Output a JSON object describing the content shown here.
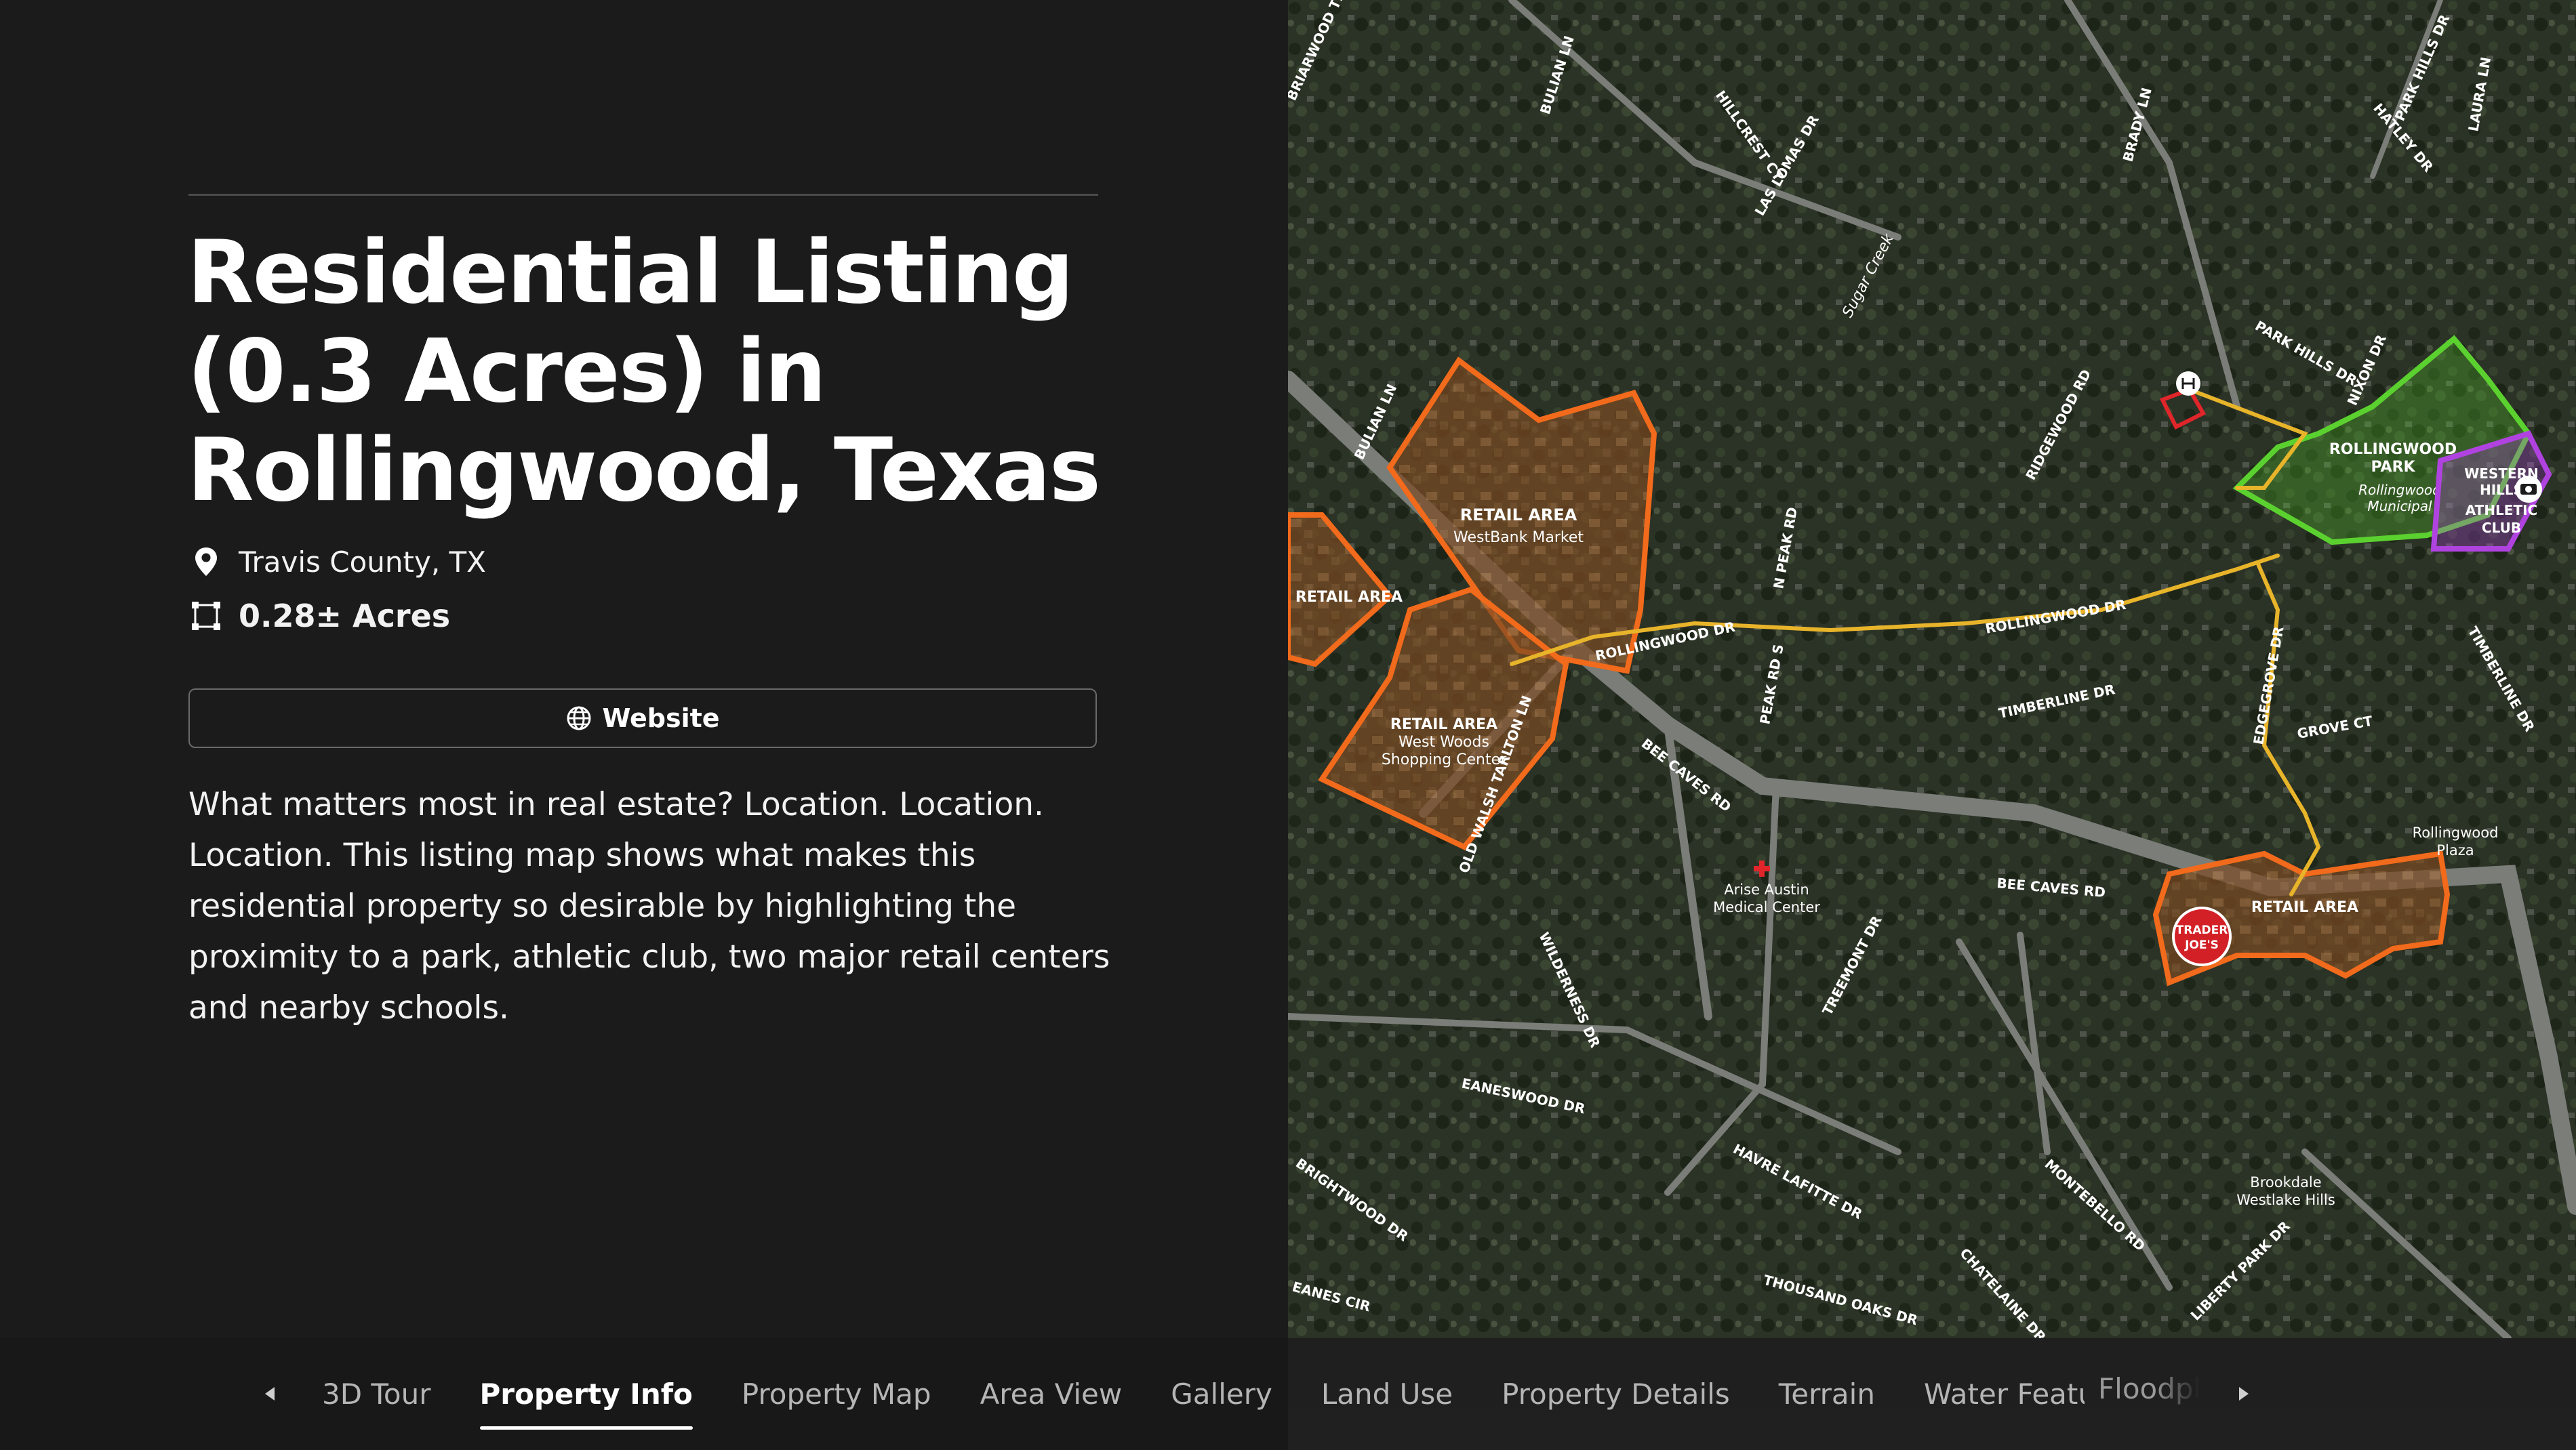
{
  "listing": {
    "title": "Residential Listing (0.3 Acres) in Rollingwood, Texas",
    "location": "Travis County, TX",
    "acreage": "0.28± Acres",
    "website_label": "Website",
    "description": "What matters most in real estate? Location. Location. Location. This listing map shows what makes this residential property so desirable by highlighting the proximity to a park, athletic club, two major retail centers and nearby schools."
  },
  "icons": {
    "location": "map-pin-icon",
    "acreage": "boundary-square-icon",
    "website": "globe-icon",
    "prev": "caret-left-icon",
    "next": "caret-right-icon"
  },
  "colors": {
    "panel_bg": "#1b1b1c",
    "retail_outline": "#f26a1b",
    "park_outline": "#5bd12f",
    "club_outline": "#b043e0",
    "route_line": "#e8b42a",
    "property_outline": "#e0262a"
  },
  "tabs": [
    {
      "label": "3D Tour",
      "active": false
    },
    {
      "label": "Property Info",
      "active": true
    },
    {
      "label": "Property Map",
      "active": false
    },
    {
      "label": "Area View",
      "active": false
    },
    {
      "label": "Gallery",
      "active": false
    },
    {
      "label": "Land Use",
      "active": false
    },
    {
      "label": "Property Details",
      "active": false
    },
    {
      "label": "Terrain",
      "active": false
    },
    {
      "label": "Water Features",
      "active": false
    }
  ],
  "tab_partial": "Floodpla",
  "map": {
    "areas": {
      "retail_westbank": [
        "RETAIL AREA",
        "WestBank Market"
      ],
      "retail_left": "RETAIL AREA",
      "retail_westwoods": [
        "RETAIL AREA",
        "West Woods",
        "Shopping Center"
      ],
      "retail_traderjoes": "RETAIL AREA",
      "park": [
        "ROLLINGWOOD",
        "PARK"
      ],
      "club": [
        "WESTERN",
        "HILLS",
        "ATHLETIC",
        "CLUB"
      ],
      "park_sub": [
        "Rollingwood",
        "Municipal"
      ]
    },
    "poi": {
      "trader_joes": [
        "TRADER",
        "JOE'S"
      ],
      "arise": [
        "Arise Austin",
        "Medical Center"
      ],
      "rollingwood_plaza": [
        "Rollingwood",
        "Plaza"
      ],
      "brookdale": [
        "Brookdale",
        "Westlake Hills"
      ],
      "sugar_creek": "Sugar Creek"
    },
    "roads": {
      "rollingwood_dr_w": "ROLLINGWOOD DR",
      "rollingwood_dr_e": "ROLLINGWOOD DR",
      "bee_caves_rd_w": "BEE CAVES RD",
      "bee_caves_rd_e": "BEE CAVES RD",
      "edgegrove_dr": "EDGEGROVE DR",
      "timberline_dr": "TIMBERLINE DR",
      "timberline_dr_e": "TIMBERLINE DR",
      "grove_ct": "GROVE CT",
      "ridgewood_rd": "RIDGEWOOD RD",
      "park_hills_dr": "PARK HILLS DR",
      "park_hills_dr_n": "PARK HILLS DR",
      "nixon_dr": "NIXON DR",
      "las_lomas_dr": "LAS LOMAS DR",
      "hillcrest_ct": "HILLCREST CT",
      "bulian_ln": "BULIAN LN",
      "bulian_ln_s": "BULIAN LN",
      "brady_ln": "BRADY LN",
      "hatley_dr": "HATLEY DR",
      "laura_ln": "LAURA LN",
      "n_peak_rd": "N PEAK RD",
      "peak_rd_s": "PEAK RD S",
      "old_walsh_tarlton_ln": "OLD WALSH TARLTON LN",
      "wilderness_dr": "WILDERNESS DR",
      "treemont_dr": "TREEMONT DR",
      "eaneswood_dr": "EANESWOOD DR",
      "brightwood_dr": "BRIGHTWOOD DR",
      "havre_lafitte_dr": "HAVRE LAFITTE DR",
      "montebello_rd": "MONTEBELLO RD",
      "chatelaine_dr": "CHATELAINE DR",
      "thousand_oaks_dr": "THOUSAND OAKS DR",
      "liberty_park_dr": "LIBERTY PARK DR",
      "briarwood_trail": "BRIARWOOD TRAIL",
      "eanes_cir": "EANES CIR"
    }
  }
}
